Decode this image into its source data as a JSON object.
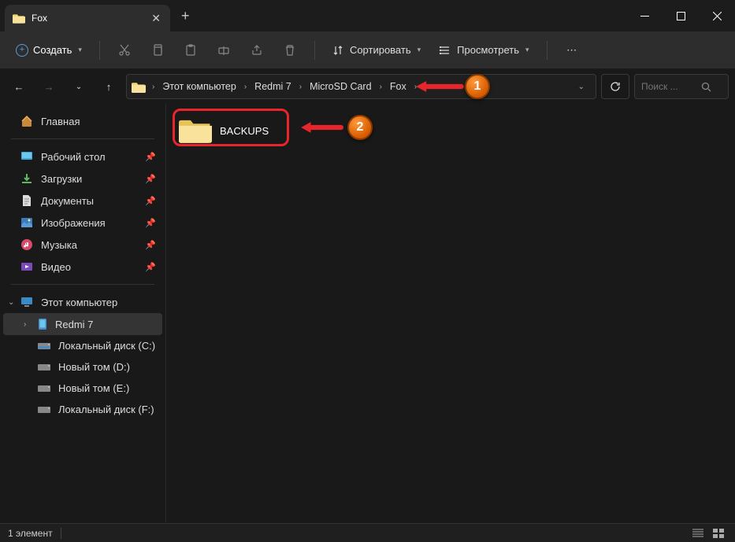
{
  "tab": {
    "title": "Fox"
  },
  "toolbar": {
    "create": "Создать",
    "sort": "Сортировать",
    "view": "Просмотреть"
  },
  "breadcrumb": {
    "items": [
      "Этот компьютер",
      "Redmi 7",
      "MicroSD Card",
      "Fox"
    ]
  },
  "search": {
    "placeholder": "Поиск ..."
  },
  "sidebar": {
    "home": "Главная",
    "quick": [
      {
        "label": "Рабочий стол"
      },
      {
        "label": "Загрузки"
      },
      {
        "label": "Документы"
      },
      {
        "label": "Изображения"
      },
      {
        "label": "Музыка"
      },
      {
        "label": "Видео"
      }
    ],
    "pc": "Этот компьютер",
    "device": "Redmi 7",
    "drives": [
      {
        "label": "Локальный диск (C:)"
      },
      {
        "label": "Новый том (D:)"
      },
      {
        "label": "Новый том (E:)"
      },
      {
        "label": "Локальный диск (F:)"
      }
    ]
  },
  "content": {
    "folder": "BACKUPS"
  },
  "status": {
    "count": "1 элемент"
  },
  "annotations": {
    "n1": "1",
    "n2": "2"
  }
}
